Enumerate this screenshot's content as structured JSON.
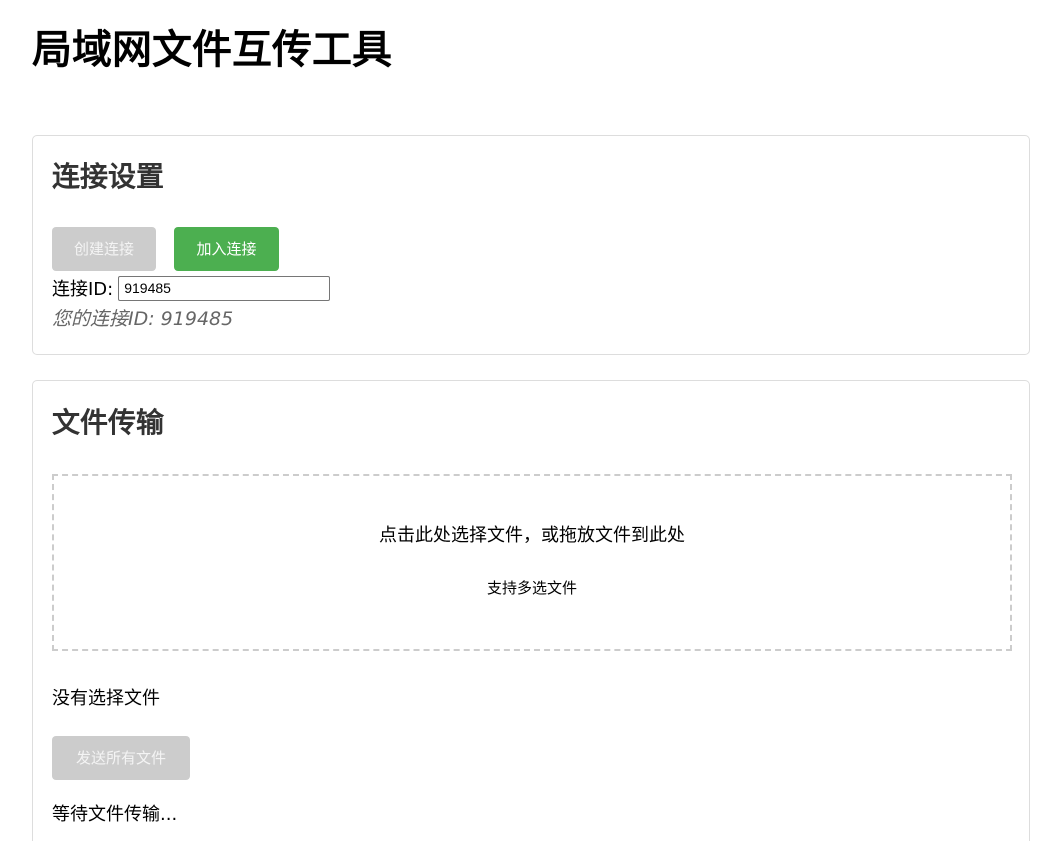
{
  "app": {
    "title": "局域网文件互传工具"
  },
  "connection": {
    "title": "连接设置",
    "create_label": "创建连接",
    "join_label": "加入连接",
    "id_label": "连接ID:",
    "id_value": "919485",
    "your_id_text": "您的连接ID: 919485"
  },
  "transfer": {
    "title": "文件传输",
    "drop_main": "点击此处选择文件，或拖放文件到此处",
    "drop_sub": "支持多选文件",
    "file_status": "没有选择文件",
    "send_label": "发送所有文件",
    "transfer_status": "等待文件传输..."
  },
  "colors": {
    "accent_green": "#4caf50",
    "disabled_gray": "#cccccc",
    "card_border": "#dddddd",
    "info_text": "#666666"
  }
}
